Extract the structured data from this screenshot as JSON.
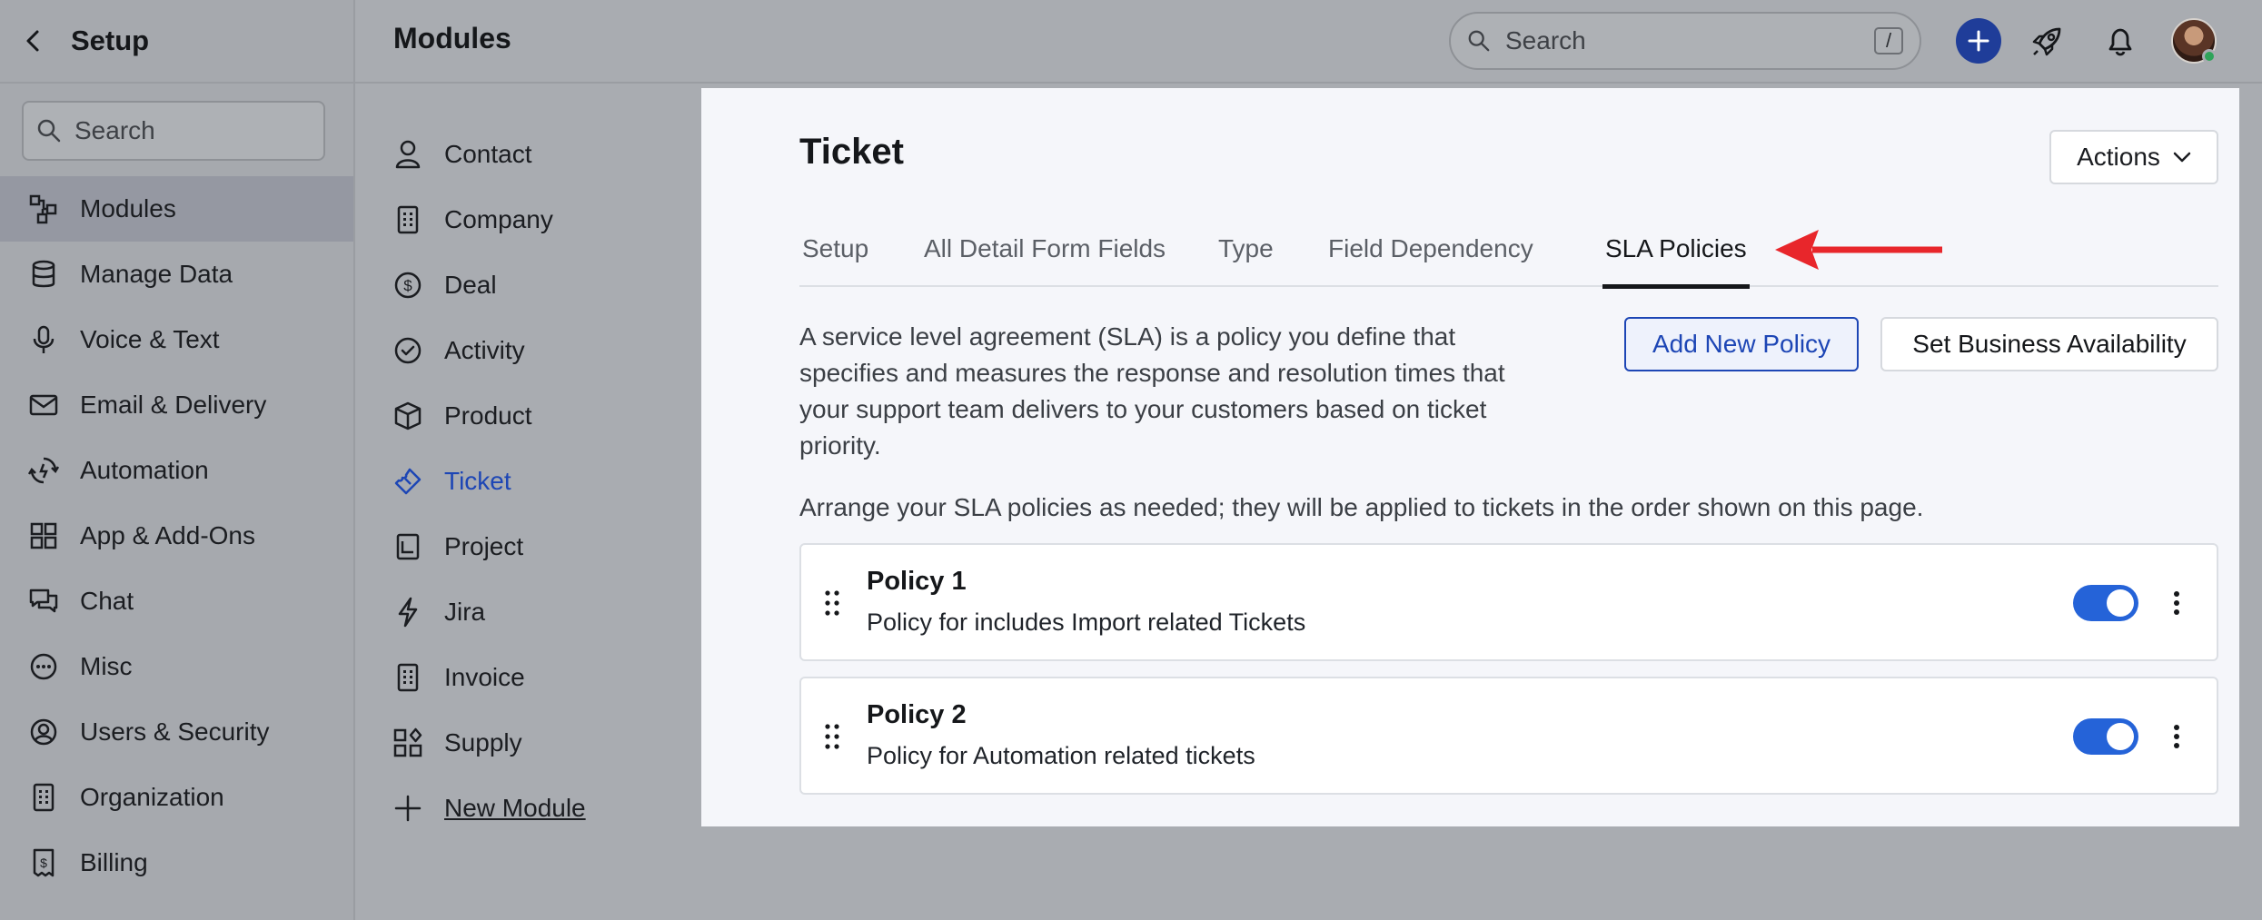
{
  "sidebar": {
    "title": "Setup",
    "search_placeholder": "Search",
    "items": [
      {
        "label": "Modules",
        "icon": "modules-icon",
        "active": true
      },
      {
        "label": "Manage Data",
        "icon": "database-icon"
      },
      {
        "label": "Voice & Text",
        "icon": "microphone-icon"
      },
      {
        "label": "Email & Delivery",
        "icon": "envelope-icon"
      },
      {
        "label": "Automation",
        "icon": "automation-icon"
      },
      {
        "label": "App & Add-Ons",
        "icon": "grid-icon"
      },
      {
        "label": "Chat",
        "icon": "chat-icon"
      },
      {
        "label": "Misc",
        "icon": "dots-circle-icon"
      },
      {
        "label": "Users & Security",
        "icon": "user-circle-icon"
      },
      {
        "label": "Organization",
        "icon": "building-icon"
      },
      {
        "label": "Billing",
        "icon": "receipt-icon"
      }
    ]
  },
  "topbar": {
    "title": "Modules",
    "search_placeholder": "Search",
    "search_shortcut": "/"
  },
  "modules": {
    "items": [
      {
        "label": "Contact",
        "icon": "person-icon"
      },
      {
        "label": "Company",
        "icon": "building-icon"
      },
      {
        "label": "Deal",
        "icon": "dollar-icon"
      },
      {
        "label": "Activity",
        "icon": "check-circle-icon"
      },
      {
        "label": "Product",
        "icon": "box-icon"
      },
      {
        "label": "Ticket",
        "icon": "ticket-icon",
        "active": true
      },
      {
        "label": "Project",
        "icon": "project-icon"
      },
      {
        "label": "Jira",
        "icon": "bolt-icon"
      },
      {
        "label": "Invoice",
        "icon": "invoice-icon"
      },
      {
        "label": "Supply",
        "icon": "supply-icon"
      }
    ],
    "new_module": "New Module"
  },
  "panel": {
    "title": "Ticket",
    "actions_label": "Actions",
    "tabs": [
      "Setup",
      "All Detail Form Fields",
      "Type",
      "Field Dependency",
      "SLA Policies"
    ],
    "active_tab": "SLA Policies",
    "description_lines": [
      "A service level agreement (SLA) is a policy you define that",
      "specifies and measures the response and resolution times that",
      "your support team delivers to your customers based on ticket",
      "priority."
    ],
    "add_policy_label": "Add New Policy",
    "business_availability_label": "Set Business Availability",
    "arrange_text": "Arrange your SLA policies as needed; they will be applied to tickets in the order shown on this page.",
    "policies": [
      {
        "name": "Policy 1",
        "description": "Policy for includes Import related Tickets",
        "enabled": true
      },
      {
        "name": "Policy 2",
        "description": "Policy for Automation related tickets",
        "enabled": true
      }
    ]
  },
  "colors": {
    "accent": "#1d46b5",
    "toggle_on": "#2563d8",
    "annotation_arrow": "#e8262b",
    "overlay": "#a9acb1"
  }
}
